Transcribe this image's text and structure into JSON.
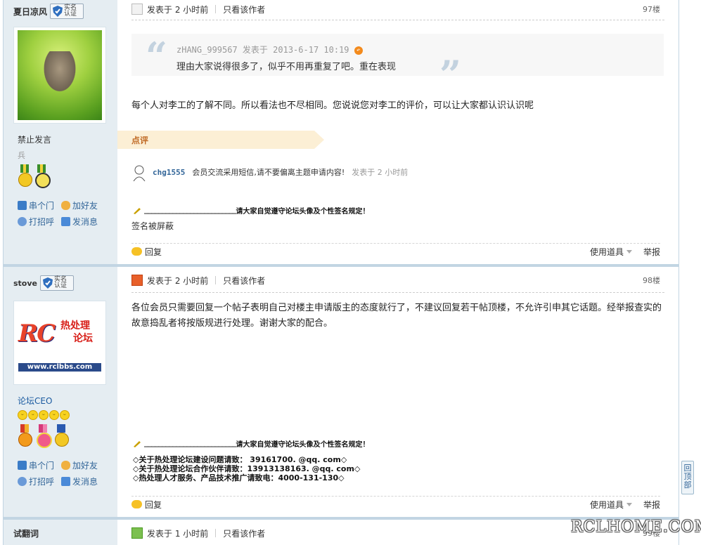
{
  "posts": [
    {
      "user": "夏日凉风",
      "badge": "实名认证",
      "status": "禁止发言",
      "rank": "兵",
      "actions": [
        "串个门",
        "加好友",
        "打招呼",
        "发消息"
      ],
      "time": "发表于 2 小时前",
      "only_author": "只看该作者",
      "floor": "97楼",
      "quote": {
        "meta": "zHANG_999567 发表于 2013-6-17 10:19",
        "text": "理由大家说得很多了，似乎不用再重复了吧。重在表现"
      },
      "body": "每个人对李工的了解不同。所以看法也不尽相同。您说说您对李工的评价，可以让大家都认识认识呢",
      "comment_label": "点评",
      "comment": {
        "user": "chg1555",
        "text": "会员交流采用短信,请不要偏离主题申请内容!",
        "time": "发表于 2 小时前"
      },
      "sig_line": "请大家自觉遵守论坛头像及个性签名规定！",
      "sig_dashes": "__________________________",
      "sig_text": "签名被屏蔽",
      "reply": "回复",
      "tools": "使用道具",
      "report": "举报"
    },
    {
      "user": "stove",
      "badge": "实名认证",
      "logo_main": "RC",
      "logo_cn1": "热处理",
      "logo_cn2": "论坛",
      "logo_url": "www.rclbbs.com",
      "status": "论坛CEO",
      "actions": [
        "串个门",
        "加好友",
        "打招呼",
        "发消息"
      ],
      "time": "发表于 2 小时前",
      "only_author": "只看该作者",
      "floor": "98楼",
      "body": "各位会员只需要回复一个帖子表明自己对楼主申请版主的态度就行了，不建议回复若干帖顶楼，不允许引申其它话题。经举报查实的故意捣乱者将按版规进行处理。谢谢大家的配合。",
      "sig_line": "请大家自觉遵守论坛头像及个性签名规定！",
      "sig_dashes": "__________________________",
      "contacts": [
        "◇关于热处理论坛建设问题请致：     39161700. @qq. com◇",
        "◇关于热处理论坛合作伙伴请致：13913138163. @qq. com◇",
        "◇热处理人才服务、产品技术推广请致电：4000-131-130◇"
      ],
      "reply": "回复",
      "tools": "使用道具",
      "report": "举报"
    },
    {
      "user": "试翻词",
      "time": "发表于 1 小时前",
      "only_author": "只看该作者",
      "floor": "99楼"
    }
  ],
  "totop": "回顶部",
  "watermark": "RCLHOME.COM"
}
